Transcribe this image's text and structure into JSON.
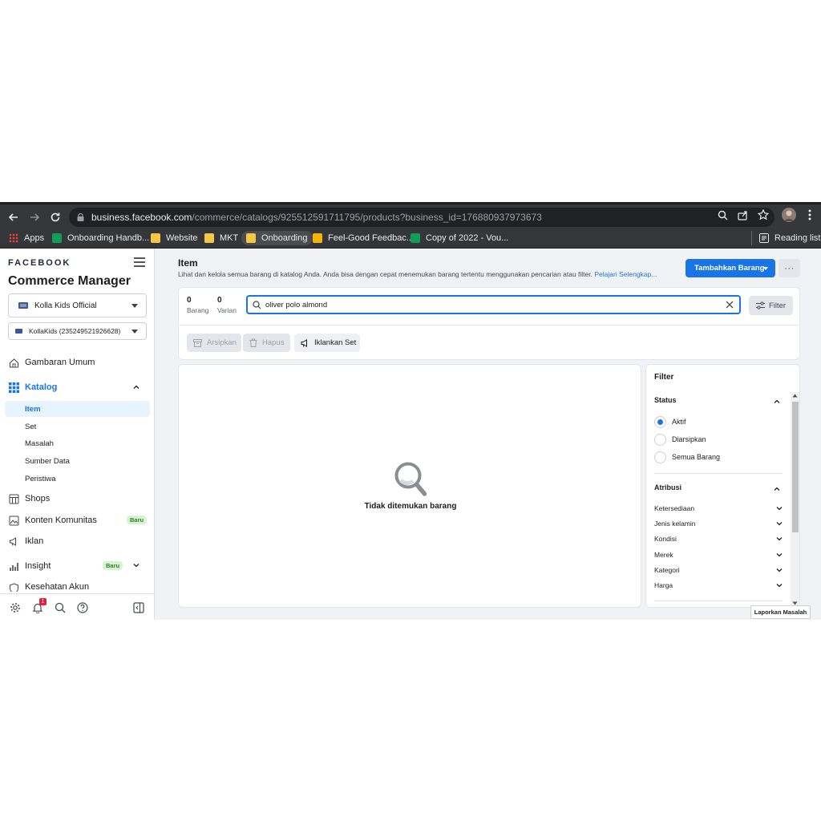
{
  "browser": {
    "url_host": "business.facebook.com",
    "url_path": "/commerce/catalogs/925512591711795/products?business_id=176880937973673"
  },
  "bookmarks": [
    {
      "label": "Apps",
      "icon": "apps-grid-icon"
    },
    {
      "label": "Onboarding Handb...",
      "icon": "sheets-icon"
    },
    {
      "label": "Website",
      "icon": "folder-icon"
    },
    {
      "label": "MKT",
      "icon": "folder-icon"
    },
    {
      "label": "Onboarding",
      "icon": "folder-icon"
    },
    {
      "label": "Feel-Good Feedbac...",
      "icon": "slides-icon"
    },
    {
      "label": "Copy of 2022 - Vou...",
      "icon": "sheets-icon"
    }
  ],
  "reading_list": "Reading list",
  "sidebar": {
    "brand": "FACEBOOK",
    "app_title": "Commerce Manager",
    "business_selector": "Kolla Kids Official",
    "catalog_selector": "KollaKids (235249521926628)",
    "items": {
      "overview": "Gambaran Umum",
      "catalog": "Katalog",
      "catalog_sub": [
        "Item",
        "Set",
        "Masalah",
        "Sumber Data",
        "Peristiwa"
      ],
      "shops": "Shops",
      "community": "Konten Komunitas",
      "ads": "Iklan",
      "insight": "Insight",
      "account_health": "Kesehatan Akun"
    },
    "badge_new": "Baru"
  },
  "main": {
    "title": "Item",
    "description": "Lihat dan kelola semua barang di katalog Anda. Anda bisa dengan cepat menemukan barang tertentu menggunakan pencarian atau filter.",
    "learn_more": "Pelajari Selengkap...",
    "add_button": "Tambahkan Barang",
    "more_button": "···"
  },
  "search": {
    "item_count": "0",
    "item_label": "Barang",
    "variant_count": "0",
    "variant_label": "Varian",
    "query": "oliver polo almond",
    "filter_button": "Filter"
  },
  "actions": {
    "archive": "Arsipkan",
    "delete": "Hapus",
    "advertise": "Iklankan Set"
  },
  "results": {
    "empty_text": "Tidak ditemukan barang"
  },
  "filter_panel": {
    "title": "Filter",
    "status_title": "Status",
    "status_options": [
      "Aktif",
      "Diarsipkan",
      "Semua Barang"
    ],
    "status_selected": "Aktif",
    "attributes_title": "Atribusi",
    "attributes": [
      "Ketersediaan",
      "Jenis kelamin",
      "Kondisi",
      "Merek",
      "Kategori",
      "Harga"
    ]
  },
  "report_button": "Laporkan Masalah",
  "notification_count": "1",
  "colors": {
    "accent": "#1b74e4",
    "browser_chrome": "#35363a",
    "page_background": "#f0f2f5"
  }
}
